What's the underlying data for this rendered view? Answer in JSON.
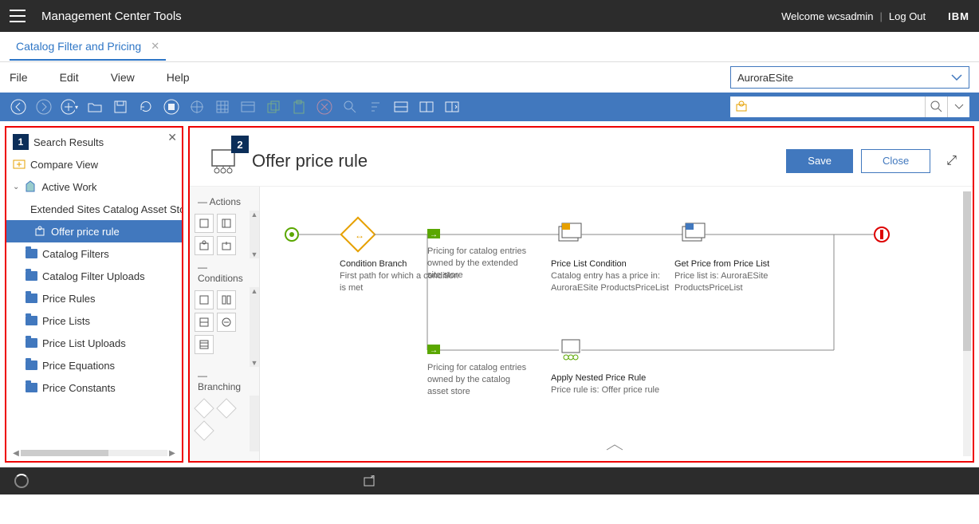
{
  "topbar": {
    "title": "Management Center Tools",
    "welcome": "Welcome wcsadmin",
    "logout": "Log Out",
    "brand": "IBM"
  },
  "tab": {
    "label": "Catalog Filter and Pricing"
  },
  "menu": {
    "file": "File",
    "edit": "Edit",
    "view": "View",
    "help": "Help",
    "store": "AuroraESite"
  },
  "sidebar": {
    "badge": "1",
    "items": [
      {
        "label": "Search Results",
        "kind": "search"
      },
      {
        "label": "Compare View",
        "kind": "compare"
      },
      {
        "label": "Active Work",
        "kind": "active",
        "expanded": true
      },
      {
        "label": "Extended Sites Catalog Asset Store",
        "kind": "catalog",
        "indent": 1
      },
      {
        "label": "Offer price rule",
        "kind": "rule",
        "indent": 2,
        "selected": true
      },
      {
        "label": "Catalog Filters",
        "kind": "folder",
        "indent": 1
      },
      {
        "label": "Catalog Filter Uploads",
        "kind": "folder",
        "indent": 1
      },
      {
        "label": "Price Rules",
        "kind": "folder",
        "indent": 1
      },
      {
        "label": "Price Lists",
        "kind": "folder",
        "indent": 1
      },
      {
        "label": "Price List Uploads",
        "kind": "folder",
        "indent": 1
      },
      {
        "label": "Price Equations",
        "kind": "folder",
        "indent": 1
      },
      {
        "label": "Price Constants",
        "kind": "folder",
        "indent": 1
      }
    ]
  },
  "editor": {
    "badge": "2",
    "title": "Offer price rule",
    "save": "Save",
    "close": "Close"
  },
  "palette": {
    "actions": "Actions",
    "conditions": "Conditions",
    "branching": "Branching"
  },
  "flow": {
    "condition_branch": {
      "title": "Condition Branch",
      "desc": "First path for which a condition is met"
    },
    "pricing_ext": {
      "title": "Pricing for catalog entries owned by the extended site store"
    },
    "pricing_cat": {
      "title": "Pricing for catalog entries owned by the catalog asset store"
    },
    "price_list_cond": {
      "title": "Price List Condition",
      "desc": "Catalog entry has a price in: AuroraESite ProductsPriceList"
    },
    "get_price": {
      "title": "Get Price from Price List",
      "desc": "Price list is: AuroraESite ProductsPriceList"
    },
    "nested": {
      "title": "Apply Nested Price Rule",
      "desc": "Price rule is: Offer price rule"
    }
  }
}
